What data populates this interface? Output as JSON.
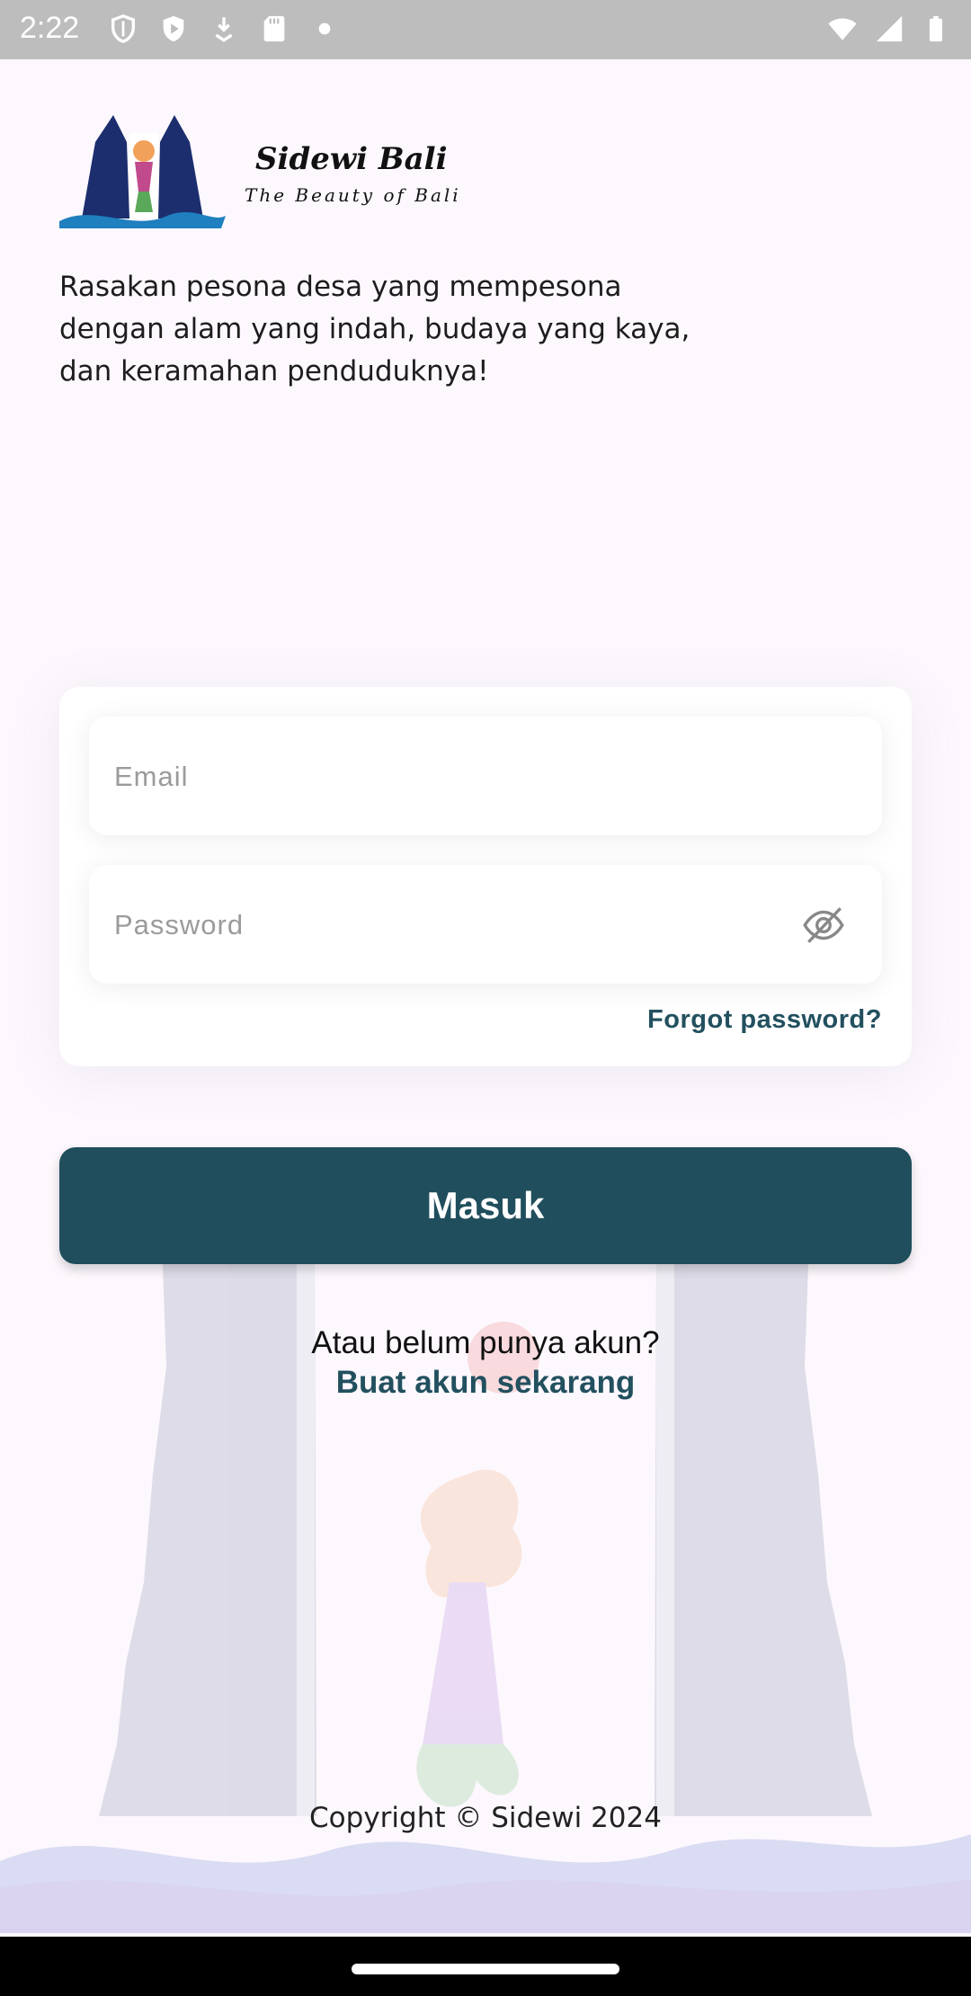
{
  "status_bar": {
    "time": "2:22",
    "left_icons": [
      "shield-icon",
      "play-protect-icon",
      "download-icon",
      "sd-card-icon",
      "dot-icon"
    ],
    "right_icons": [
      "wifi-icon",
      "signal-icon",
      "battery-icon"
    ]
  },
  "brand": {
    "logo_title": "Sidewi Bali",
    "logo_subtitle": "The Beauty of Bali",
    "tagline": "Rasakan pesona desa yang mempesona dengan alam yang indah, budaya yang kaya, dan keramahan penduduknya!"
  },
  "form": {
    "email_placeholder": "Email",
    "email_value": "",
    "password_placeholder": "Password",
    "password_value": "",
    "forgot_label": "Forgot password?"
  },
  "login_button_label": "Masuk",
  "signup": {
    "prompt": "Atau belum punya akun?",
    "link": "Buat akun sekarang"
  },
  "footer": {
    "copyright": "Copyright © Sidewi 2024"
  },
  "colors": {
    "primary": "#204e5c",
    "link": "#22505f",
    "background": "#fdf8fd"
  }
}
